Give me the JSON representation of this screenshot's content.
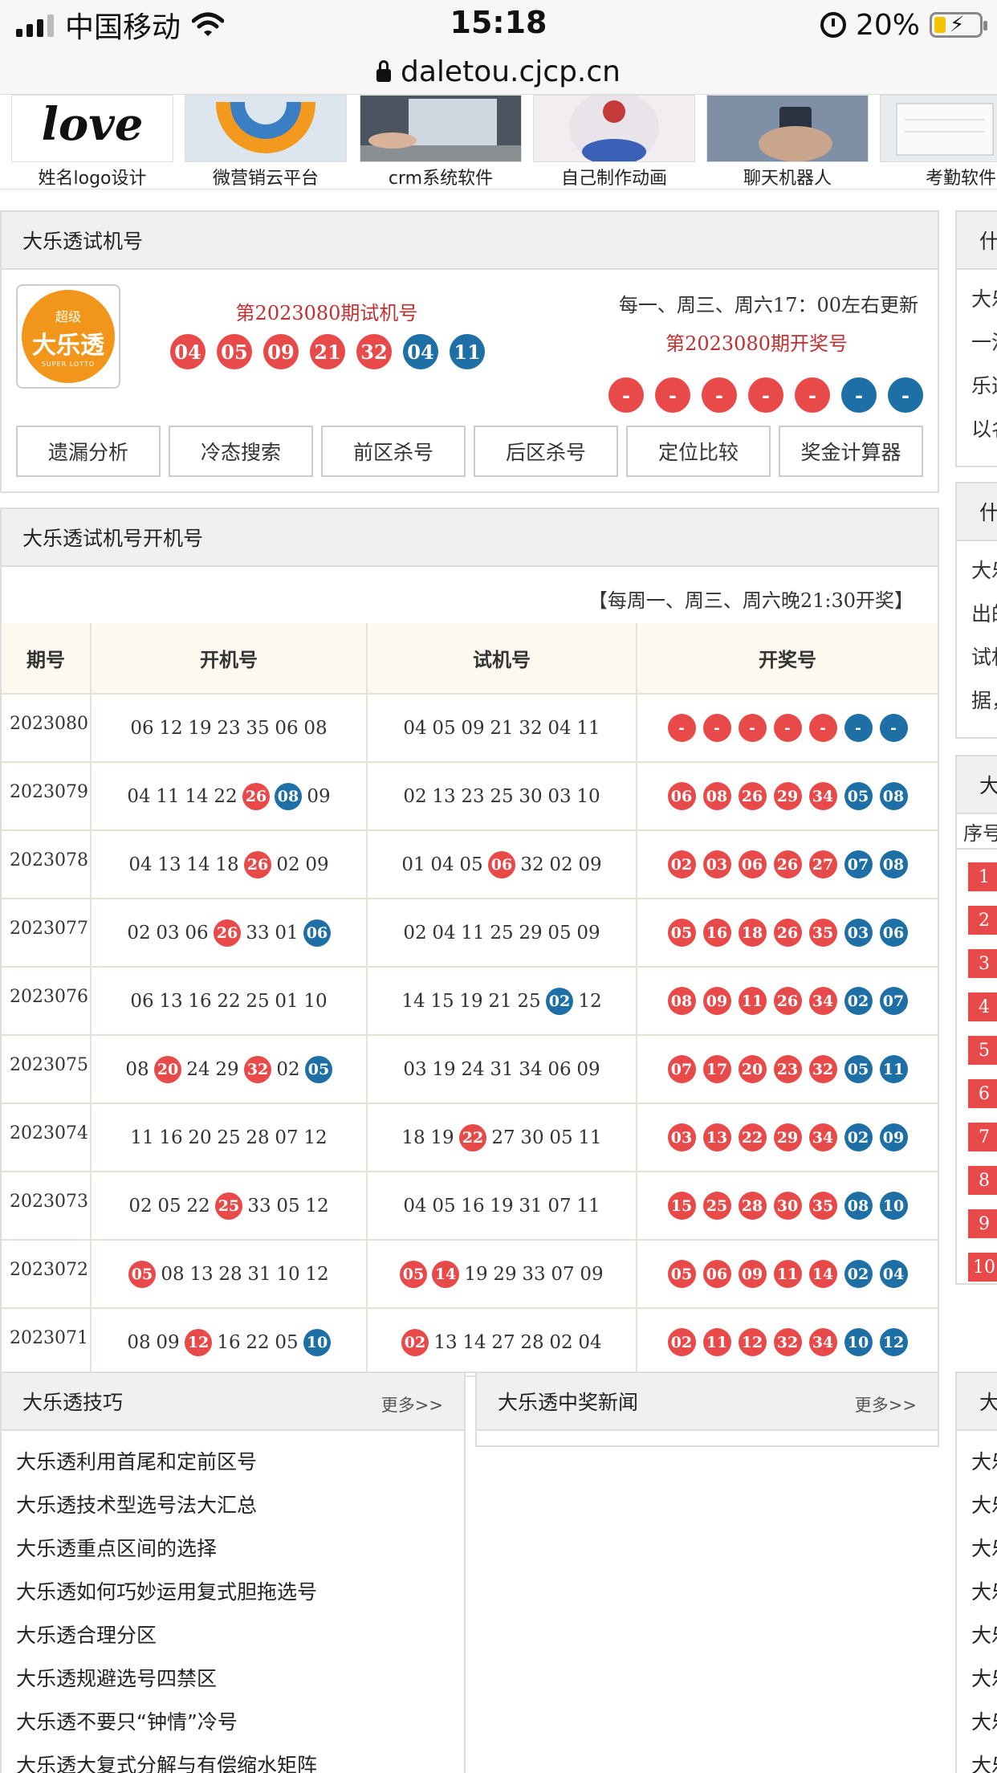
{
  "status_bar": {
    "carrier": "中国移动",
    "time": "15:18",
    "battery": "20%"
  },
  "url_bar": {
    "url": "daletou.cjcp.cn"
  },
  "ads": [
    "姓名logo设计",
    "微营销云平台",
    "crm系统软件",
    "自己制作动画",
    "聊天机器人",
    "考勤软件"
  ],
  "ad_logo_text": "love",
  "trial_panel": {
    "title": "大乐透试机号",
    "logo_top": "超级",
    "logo_main": "大乐透",
    "logo_sub": "SUPER LOTTO",
    "trial_period": "第2023080期试机号",
    "trial_balls": {
      "red": [
        "04",
        "05",
        "09",
        "21",
        "32"
      ],
      "blue": [
        "04",
        "11"
      ]
    },
    "update_note": "每一、周三、周六17：00左右更新",
    "draw_period": "第2023080期开奖号",
    "draw_balls": {
      "red": [
        "-",
        "-",
        "-",
        "-",
        "-"
      ],
      "blue": [
        "-",
        "-"
      ]
    },
    "buttons": [
      "遗漏分析",
      "冷态搜索",
      "前区杀号",
      "后区杀号",
      "定位比较",
      "奖金计算器"
    ]
  },
  "results_panel": {
    "title": "大乐透试机号开机号",
    "notice": "【每周一、周三、周六晚21:30开奖】",
    "columns": [
      "期号",
      "开机号",
      "试机号",
      "开奖号"
    ],
    "rows": [
      {
        "period": "2023080",
        "open": [
          [
            "06",
            ""
          ],
          [
            "12",
            ""
          ],
          [
            "19",
            ""
          ],
          [
            "23",
            ""
          ],
          [
            "35",
            ""
          ],
          [
            "06",
            ""
          ],
          [
            "08",
            ""
          ]
        ],
        "trial": [
          [
            "04",
            ""
          ],
          [
            "05",
            ""
          ],
          [
            "09",
            ""
          ],
          [
            "21",
            ""
          ],
          [
            "32",
            ""
          ],
          [
            "04",
            ""
          ],
          [
            "11",
            ""
          ]
        ],
        "prize": [
          "-",
          "-",
          "-",
          "-",
          "-",
          "-",
          "-"
        ]
      },
      {
        "period": "2023079",
        "open": [
          [
            "04",
            ""
          ],
          [
            "11",
            ""
          ],
          [
            "14",
            ""
          ],
          [
            "22",
            ""
          ],
          [
            "26",
            "red"
          ],
          [
            "08",
            "blue"
          ],
          [
            "09",
            ""
          ]
        ],
        "trial": [
          [
            "02",
            ""
          ],
          [
            "13",
            ""
          ],
          [
            "23",
            ""
          ],
          [
            "25",
            ""
          ],
          [
            "30",
            ""
          ],
          [
            "03",
            ""
          ],
          [
            "10",
            ""
          ]
        ],
        "prize": [
          "06",
          "08",
          "26",
          "29",
          "34",
          "05",
          "08"
        ]
      },
      {
        "period": "2023078",
        "open": [
          [
            "04",
            ""
          ],
          [
            "13",
            ""
          ],
          [
            "14",
            ""
          ],
          [
            "18",
            ""
          ],
          [
            "26",
            "red"
          ],
          [
            "02",
            ""
          ],
          [
            "09",
            ""
          ]
        ],
        "trial": [
          [
            "01",
            ""
          ],
          [
            "04",
            ""
          ],
          [
            "05",
            ""
          ],
          [
            "06",
            "red"
          ],
          [
            "32",
            ""
          ],
          [
            "02",
            ""
          ],
          [
            "09",
            ""
          ]
        ],
        "prize": [
          "02",
          "03",
          "06",
          "26",
          "27",
          "07",
          "08"
        ]
      },
      {
        "period": "2023077",
        "open": [
          [
            "02",
            ""
          ],
          [
            "03",
            ""
          ],
          [
            "06",
            ""
          ],
          [
            "26",
            "red"
          ],
          [
            "33",
            ""
          ],
          [
            "01",
            ""
          ],
          [
            "06",
            "blue"
          ]
        ],
        "trial": [
          [
            "02",
            ""
          ],
          [
            "04",
            ""
          ],
          [
            "11",
            ""
          ],
          [
            "25",
            ""
          ],
          [
            "29",
            ""
          ],
          [
            "05",
            ""
          ],
          [
            "09",
            ""
          ]
        ],
        "prize": [
          "05",
          "16",
          "18",
          "26",
          "35",
          "03",
          "06"
        ]
      },
      {
        "period": "2023076",
        "open": [
          [
            "06",
            ""
          ],
          [
            "13",
            ""
          ],
          [
            "16",
            ""
          ],
          [
            "22",
            ""
          ],
          [
            "25",
            ""
          ],
          [
            "01",
            ""
          ],
          [
            "10",
            ""
          ]
        ],
        "trial": [
          [
            "14",
            ""
          ],
          [
            "15",
            ""
          ],
          [
            "19",
            ""
          ],
          [
            "21",
            ""
          ],
          [
            "25",
            ""
          ],
          [
            "02",
            "blue"
          ],
          [
            "12",
            ""
          ]
        ],
        "prize": [
          "08",
          "09",
          "11",
          "26",
          "34",
          "02",
          "07"
        ]
      },
      {
        "period": "2023075",
        "open": [
          [
            "08",
            ""
          ],
          [
            "20",
            "red"
          ],
          [
            "24",
            ""
          ],
          [
            "29",
            ""
          ],
          [
            "32",
            "red"
          ],
          [
            "02",
            ""
          ],
          [
            "05",
            "blue"
          ]
        ],
        "trial": [
          [
            "03",
            ""
          ],
          [
            "19",
            ""
          ],
          [
            "24",
            ""
          ],
          [
            "31",
            ""
          ],
          [
            "34",
            ""
          ],
          [
            "06",
            ""
          ],
          [
            "09",
            ""
          ]
        ],
        "prize": [
          "07",
          "17",
          "20",
          "23",
          "32",
          "05",
          "11"
        ]
      },
      {
        "period": "2023074",
        "open": [
          [
            "11",
            ""
          ],
          [
            "16",
            ""
          ],
          [
            "20",
            ""
          ],
          [
            "25",
            ""
          ],
          [
            "28",
            ""
          ],
          [
            "07",
            ""
          ],
          [
            "12",
            ""
          ]
        ],
        "trial": [
          [
            "18",
            ""
          ],
          [
            "19",
            ""
          ],
          [
            "22",
            "red"
          ],
          [
            "27",
            ""
          ],
          [
            "30",
            ""
          ],
          [
            "05",
            ""
          ],
          [
            "11",
            ""
          ]
        ],
        "prize": [
          "03",
          "13",
          "22",
          "29",
          "34",
          "02",
          "09"
        ]
      },
      {
        "period": "2023073",
        "open": [
          [
            "02",
            ""
          ],
          [
            "05",
            ""
          ],
          [
            "22",
            ""
          ],
          [
            "25",
            "red"
          ],
          [
            "33",
            ""
          ],
          [
            "05",
            ""
          ],
          [
            "12",
            ""
          ]
        ],
        "trial": [
          [
            "04",
            ""
          ],
          [
            "05",
            ""
          ],
          [
            "16",
            ""
          ],
          [
            "19",
            ""
          ],
          [
            "31",
            ""
          ],
          [
            "07",
            ""
          ],
          [
            "11",
            ""
          ]
        ],
        "prize": [
          "15",
          "25",
          "28",
          "30",
          "35",
          "08",
          "10"
        ]
      },
      {
        "period": "2023072",
        "open": [
          [
            "05",
            "red"
          ],
          [
            "08",
            ""
          ],
          [
            "13",
            ""
          ],
          [
            "28",
            ""
          ],
          [
            "31",
            ""
          ],
          [
            "10",
            ""
          ],
          [
            "12",
            ""
          ]
        ],
        "trial": [
          [
            "05",
            "red"
          ],
          [
            "14",
            "red"
          ],
          [
            "19",
            ""
          ],
          [
            "29",
            ""
          ],
          [
            "33",
            ""
          ],
          [
            "07",
            ""
          ],
          [
            "09",
            ""
          ]
        ],
        "prize": [
          "05",
          "06",
          "09",
          "11",
          "14",
          "02",
          "04"
        ]
      },
      {
        "period": "2023071",
        "open": [
          [
            "08",
            ""
          ],
          [
            "09",
            ""
          ],
          [
            "12",
            "red"
          ],
          [
            "16",
            ""
          ],
          [
            "22",
            ""
          ],
          [
            "05",
            ""
          ],
          [
            "10",
            "blue"
          ]
        ],
        "trial": [
          [
            "02",
            "red"
          ],
          [
            "13",
            ""
          ],
          [
            "14",
            ""
          ],
          [
            "27",
            ""
          ],
          [
            "28",
            ""
          ],
          [
            "02",
            ""
          ],
          [
            "04",
            ""
          ]
        ],
        "prize": [
          "02",
          "11",
          "12",
          "32",
          "34",
          "10",
          "12"
        ]
      }
    ]
  },
  "tips_panel": {
    "title": "大乐透技巧",
    "more": "更多>>",
    "items": [
      "大乐透利用首尾和定前区号",
      "大乐透技术型选号法大汇总",
      "大乐透重点区间的选择",
      "大乐透如何巧妙运用复式胆拖选号",
      "大乐透合理分区",
      "大乐透规避选号四禁区",
      "大乐透不要只“钟情”冷号",
      "大乐透大复式分解与有偿缩水矩阵"
    ]
  },
  "news_panel": {
    "title": "大乐透中奖新闻",
    "more": "更多>>"
  },
  "side": {
    "head1": "什",
    "text1": [
      "大乐",
      "一注",
      "乐透",
      "以名"
    ],
    "head2": "什",
    "text2": [
      "大乐",
      "出的",
      "试机",
      "据，"
    ],
    "head3": "大",
    "rank_head": "序号",
    "ranks": [
      "1",
      "2",
      "3",
      "4",
      "5",
      "6",
      "7",
      "8",
      "9",
      "10"
    ],
    "head4": "大",
    "list4": [
      "大乐",
      "大乐",
      "大乐",
      "大乐",
      "大乐",
      "大乐",
      "大乐",
      "大乐"
    ]
  },
  "colors": {
    "red_ball": "#e84a4a",
    "blue_ball": "#1d6fa5",
    "title_red": "#c03030"
  }
}
